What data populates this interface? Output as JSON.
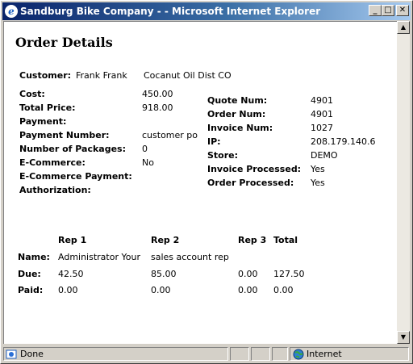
{
  "window": {
    "title": "Sandburg Bike Company - - Microsoft Internet Explorer",
    "minimize": "_",
    "maximize": "□",
    "close": "✕"
  },
  "page": {
    "title": "Order Details"
  },
  "customer": {
    "label": "Customer:",
    "name": "Frank Frank",
    "company": "Cocanut Oil Dist CO"
  },
  "left_fields": [
    {
      "label": "Cost:",
      "value": "450.00"
    },
    {
      "label": "Total Price:",
      "value": "918.00"
    },
    {
      "label": "Payment:",
      "value": ""
    },
    {
      "label": "Payment Number:",
      "value": "customer po"
    },
    {
      "label": "Number of Packages:",
      "value": "0"
    },
    {
      "label": "E-Commerce:",
      "value": "No"
    },
    {
      "label": "E-Commerce Payment:",
      "value": ""
    },
    {
      "label": "Authorization:",
      "value": ""
    }
  ],
  "right_fields": [
    {
      "label": "Quote Num:",
      "value": "4901"
    },
    {
      "label": "Order Num:",
      "value": "4901"
    },
    {
      "label": "Invoice Num:",
      "value": "1027"
    },
    {
      "label": "IP:",
      "value": "208.179.140.6"
    },
    {
      "label": "Store:",
      "value": "DEMO"
    },
    {
      "label": "Invoice Processed:",
      "value": "Yes"
    },
    {
      "label": "Order Processed:",
      "value": "Yes"
    }
  ],
  "reps": {
    "headers": [
      "Rep 1",
      "Rep 2",
      "Rep 3",
      "Total"
    ],
    "rows": [
      {
        "label": "Name:",
        "values": [
          "Administrator Your",
          "sales account rep",
          "",
          ""
        ]
      },
      {
        "label": "Due:",
        "values": [
          "42.50",
          "85.00",
          "0.00",
          "127.50"
        ]
      },
      {
        "label": "Paid:",
        "values": [
          "0.00",
          "0.00",
          "0.00",
          "0.00"
        ]
      }
    ]
  },
  "statusbar": {
    "status": "Done",
    "zone": "Internet"
  }
}
